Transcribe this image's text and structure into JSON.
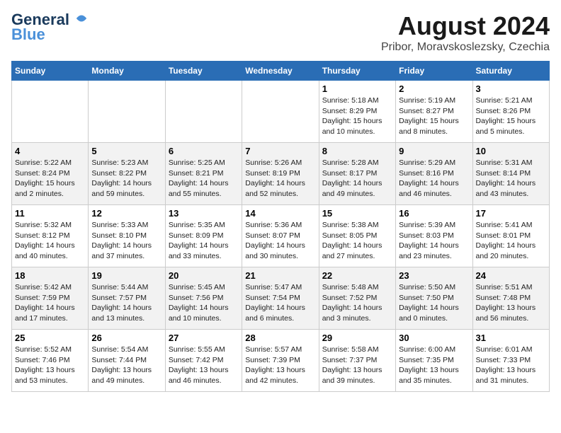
{
  "header": {
    "logo_line1": "General",
    "logo_line2": "Blue",
    "title": "August 2024",
    "subtitle": "Pribor, Moravskoslezsky, Czechia"
  },
  "weekdays": [
    "Sunday",
    "Monday",
    "Tuesday",
    "Wednesday",
    "Thursday",
    "Friday",
    "Saturday"
  ],
  "weeks": [
    [
      {
        "day": "",
        "info": ""
      },
      {
        "day": "",
        "info": ""
      },
      {
        "day": "",
        "info": ""
      },
      {
        "day": "",
        "info": ""
      },
      {
        "day": "1",
        "info": "Sunrise: 5:18 AM\nSunset: 8:29 PM\nDaylight: 15 hours\nand 10 minutes."
      },
      {
        "day": "2",
        "info": "Sunrise: 5:19 AM\nSunset: 8:27 PM\nDaylight: 15 hours\nand 8 minutes."
      },
      {
        "day": "3",
        "info": "Sunrise: 5:21 AM\nSunset: 8:26 PM\nDaylight: 15 hours\nand 5 minutes."
      }
    ],
    [
      {
        "day": "4",
        "info": "Sunrise: 5:22 AM\nSunset: 8:24 PM\nDaylight: 15 hours\nand 2 minutes."
      },
      {
        "day": "5",
        "info": "Sunrise: 5:23 AM\nSunset: 8:22 PM\nDaylight: 14 hours\nand 59 minutes."
      },
      {
        "day": "6",
        "info": "Sunrise: 5:25 AM\nSunset: 8:21 PM\nDaylight: 14 hours\nand 55 minutes."
      },
      {
        "day": "7",
        "info": "Sunrise: 5:26 AM\nSunset: 8:19 PM\nDaylight: 14 hours\nand 52 minutes."
      },
      {
        "day": "8",
        "info": "Sunrise: 5:28 AM\nSunset: 8:17 PM\nDaylight: 14 hours\nand 49 minutes."
      },
      {
        "day": "9",
        "info": "Sunrise: 5:29 AM\nSunset: 8:16 PM\nDaylight: 14 hours\nand 46 minutes."
      },
      {
        "day": "10",
        "info": "Sunrise: 5:31 AM\nSunset: 8:14 PM\nDaylight: 14 hours\nand 43 minutes."
      }
    ],
    [
      {
        "day": "11",
        "info": "Sunrise: 5:32 AM\nSunset: 8:12 PM\nDaylight: 14 hours\nand 40 minutes."
      },
      {
        "day": "12",
        "info": "Sunrise: 5:33 AM\nSunset: 8:10 PM\nDaylight: 14 hours\nand 37 minutes."
      },
      {
        "day": "13",
        "info": "Sunrise: 5:35 AM\nSunset: 8:09 PM\nDaylight: 14 hours\nand 33 minutes."
      },
      {
        "day": "14",
        "info": "Sunrise: 5:36 AM\nSunset: 8:07 PM\nDaylight: 14 hours\nand 30 minutes."
      },
      {
        "day": "15",
        "info": "Sunrise: 5:38 AM\nSunset: 8:05 PM\nDaylight: 14 hours\nand 27 minutes."
      },
      {
        "day": "16",
        "info": "Sunrise: 5:39 AM\nSunset: 8:03 PM\nDaylight: 14 hours\nand 23 minutes."
      },
      {
        "day": "17",
        "info": "Sunrise: 5:41 AM\nSunset: 8:01 PM\nDaylight: 14 hours\nand 20 minutes."
      }
    ],
    [
      {
        "day": "18",
        "info": "Sunrise: 5:42 AM\nSunset: 7:59 PM\nDaylight: 14 hours\nand 17 minutes."
      },
      {
        "day": "19",
        "info": "Sunrise: 5:44 AM\nSunset: 7:57 PM\nDaylight: 14 hours\nand 13 minutes."
      },
      {
        "day": "20",
        "info": "Sunrise: 5:45 AM\nSunset: 7:56 PM\nDaylight: 14 hours\nand 10 minutes."
      },
      {
        "day": "21",
        "info": "Sunrise: 5:47 AM\nSunset: 7:54 PM\nDaylight: 14 hours\nand 6 minutes."
      },
      {
        "day": "22",
        "info": "Sunrise: 5:48 AM\nSunset: 7:52 PM\nDaylight: 14 hours\nand 3 minutes."
      },
      {
        "day": "23",
        "info": "Sunrise: 5:50 AM\nSunset: 7:50 PM\nDaylight: 14 hours\nand 0 minutes."
      },
      {
        "day": "24",
        "info": "Sunrise: 5:51 AM\nSunset: 7:48 PM\nDaylight: 13 hours\nand 56 minutes."
      }
    ],
    [
      {
        "day": "25",
        "info": "Sunrise: 5:52 AM\nSunset: 7:46 PM\nDaylight: 13 hours\nand 53 minutes."
      },
      {
        "day": "26",
        "info": "Sunrise: 5:54 AM\nSunset: 7:44 PM\nDaylight: 13 hours\nand 49 minutes."
      },
      {
        "day": "27",
        "info": "Sunrise: 5:55 AM\nSunset: 7:42 PM\nDaylight: 13 hours\nand 46 minutes."
      },
      {
        "day": "28",
        "info": "Sunrise: 5:57 AM\nSunset: 7:39 PM\nDaylight: 13 hours\nand 42 minutes."
      },
      {
        "day": "29",
        "info": "Sunrise: 5:58 AM\nSunset: 7:37 PM\nDaylight: 13 hours\nand 39 minutes."
      },
      {
        "day": "30",
        "info": "Sunrise: 6:00 AM\nSunset: 7:35 PM\nDaylight: 13 hours\nand 35 minutes."
      },
      {
        "day": "31",
        "info": "Sunrise: 6:01 AM\nSunset: 7:33 PM\nDaylight: 13 hours\nand 31 minutes."
      }
    ]
  ]
}
